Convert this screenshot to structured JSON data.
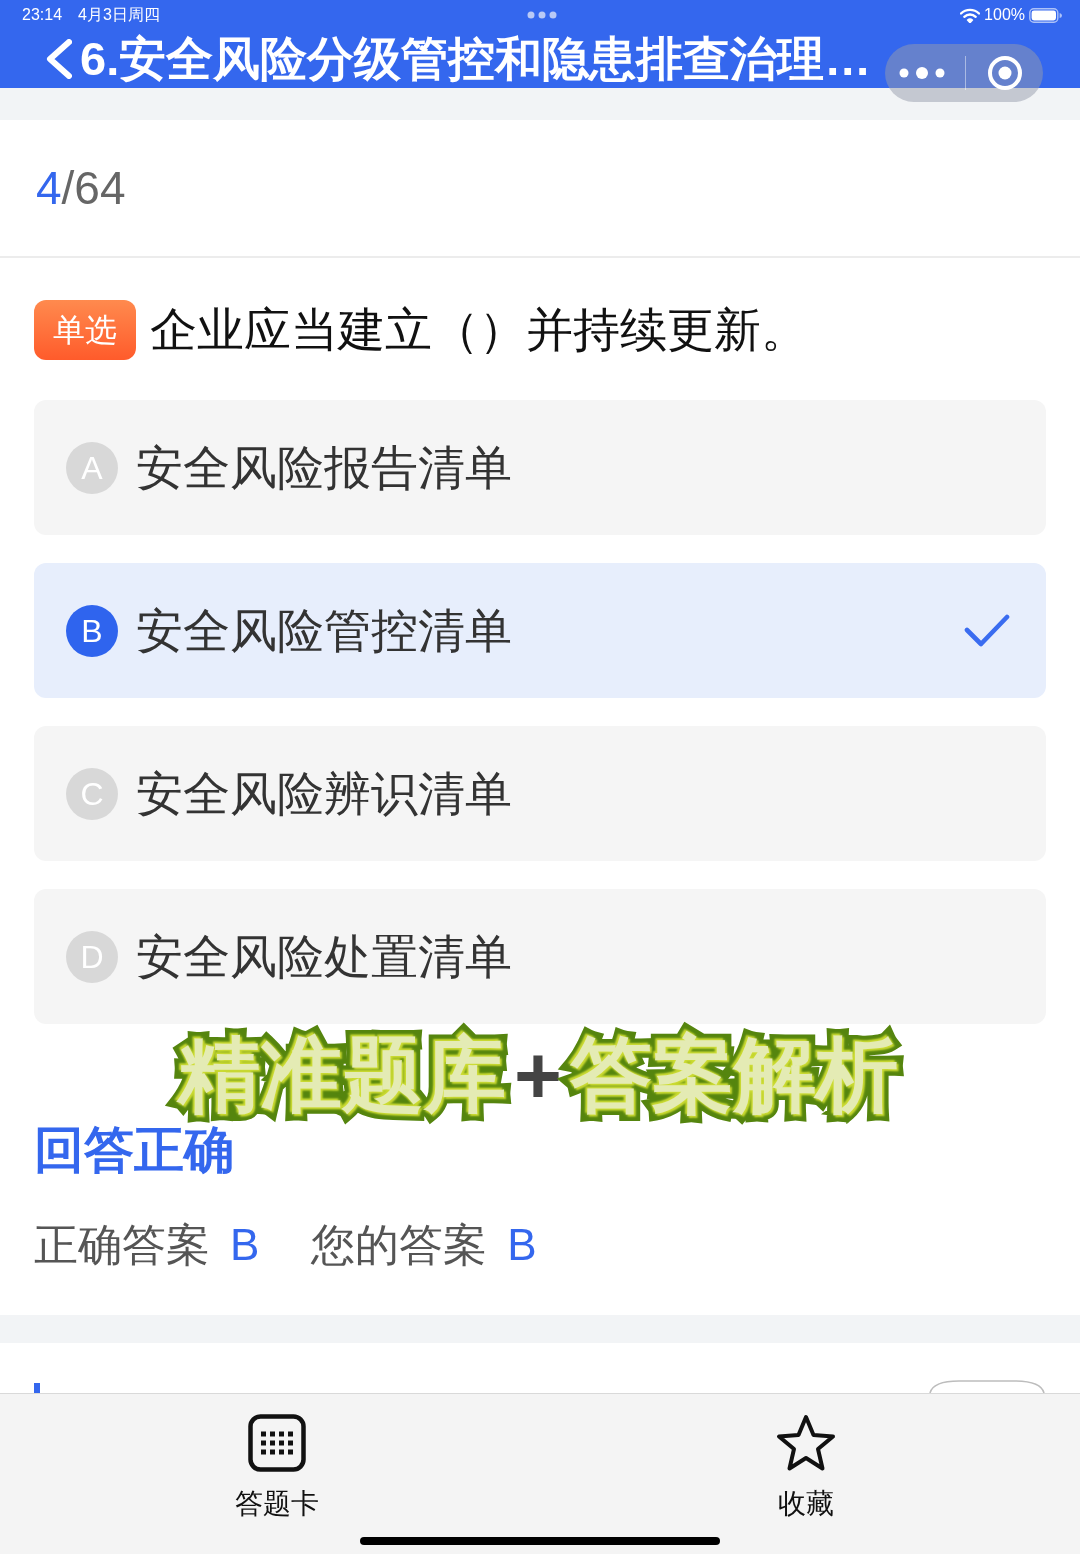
{
  "status_bar": {
    "time": "23:14",
    "date": "4月3日周四",
    "battery": "100%"
  },
  "nav": {
    "title": "6.安全风险分级管控和隐患排查治理…"
  },
  "progress": {
    "current": "4",
    "total": "/64"
  },
  "question": {
    "type_badge": "单选",
    "text": "企业应当建立（）并持续更新。"
  },
  "options": [
    {
      "letter": "A",
      "text": "安全风险报告清单",
      "selected": false
    },
    {
      "letter": "B",
      "text": "安全风险管控清单",
      "selected": true
    },
    {
      "letter": "C",
      "text": "安全风险辨识清单",
      "selected": false
    },
    {
      "letter": "D",
      "text": "安全风险处置清单",
      "selected": false
    }
  ],
  "overlay_caption": {
    "left": "精准题库",
    "joiner": "+",
    "right": "答案解析"
  },
  "result": {
    "status": "回答正确",
    "correct_label": "正确答案",
    "correct_answer": "B",
    "your_label": "您的答案",
    "your_answer": "B"
  },
  "tab_bar": {
    "tabs": [
      {
        "kind": "sheet",
        "label": "答题卡"
      },
      {
        "kind": "favorite",
        "label": "收藏"
      }
    ]
  }
}
